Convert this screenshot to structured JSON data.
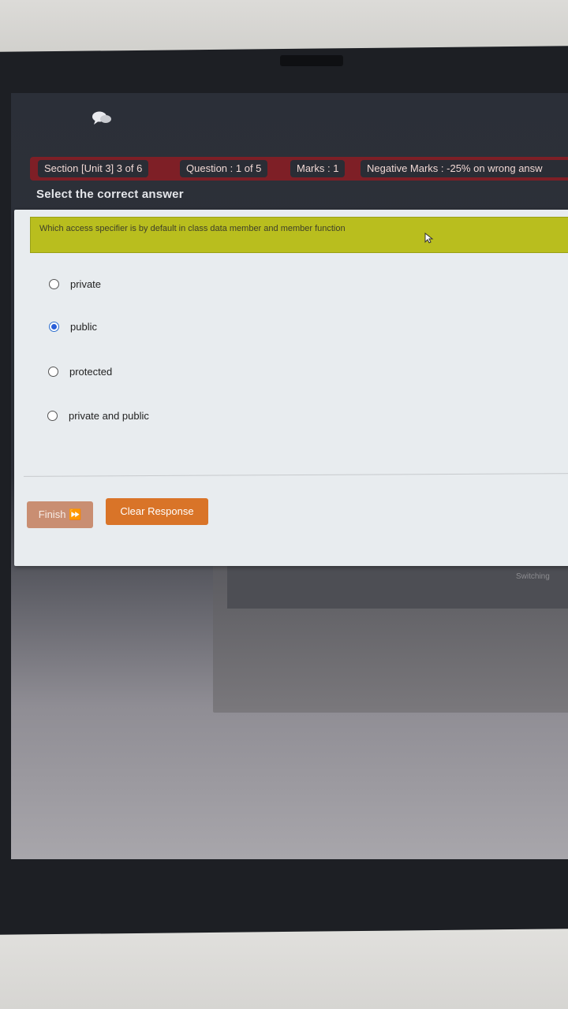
{
  "header": {
    "section": "Section [Unit 3] 3 of 6",
    "question": "Question : 1 of 5",
    "marks": "Marks : 1",
    "negative": "Negative Marks : -25% on wrong answ"
  },
  "instruction": "Select the correct answer",
  "question": {
    "text": "Which access specifier is by default in class data member and member function"
  },
  "options": [
    {
      "label": "private",
      "selected": false
    },
    {
      "label": "public",
      "selected": true
    },
    {
      "label": "protected",
      "selected": false
    },
    {
      "label": "private and public",
      "selected": false
    }
  ],
  "buttons": {
    "finish": "Finish ⏩",
    "clear": "Clear Response"
  },
  "background_window": {
    "label": "Switching"
  },
  "colors": {
    "info_bar": "#7e1f26",
    "question_box": "#b9be1e",
    "clear_button": "#d97428",
    "finish_button": "#c98e72",
    "radio_selected": "#2a5fd8"
  },
  "icons": [
    "chat-icon",
    "cursor-icon",
    "exit-icon"
  ]
}
